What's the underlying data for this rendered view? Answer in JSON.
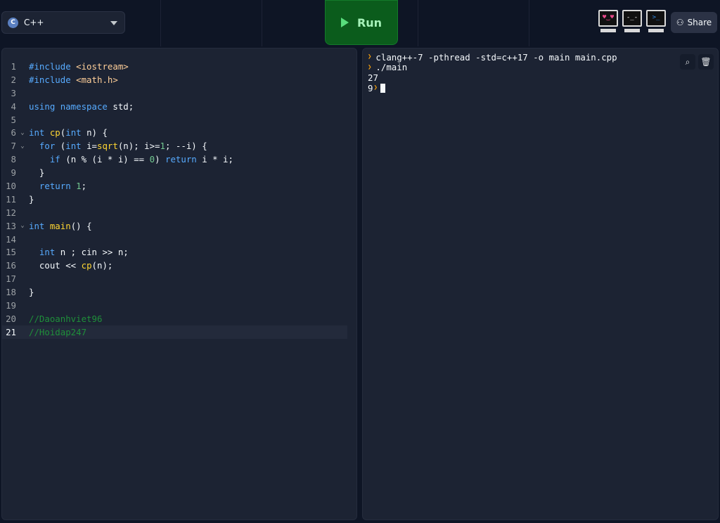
{
  "header": {
    "language": "C++",
    "run_label": "Run",
    "share_label": "Share",
    "avatars": [
      {
        "face": "♥‿♥",
        "color": "#e84a8a"
      },
      {
        "face": "-_-",
        "color": "#cccccc"
      },
      {
        "face": ">_",
        "color": "#2f8be8"
      }
    ]
  },
  "editor": {
    "active_line": 21,
    "lines": [
      {
        "n": "1",
        "fold": false,
        "html": [
          [
            "c-pp",
            "#include "
          ],
          [
            "c-str",
            "<iostream>"
          ]
        ]
      },
      {
        "n": "2",
        "fold": false,
        "html": [
          [
            "c-pp",
            "#include "
          ],
          [
            "c-str",
            "<math.h>"
          ]
        ]
      },
      {
        "n": "3",
        "fold": false,
        "html": []
      },
      {
        "n": "4",
        "fold": false,
        "html": [
          [
            "c-kw",
            "using namespace "
          ],
          [
            "c-txt",
            "std;"
          ]
        ]
      },
      {
        "n": "5",
        "fold": false,
        "html": []
      },
      {
        "n": "6",
        "fold": true,
        "html": [
          [
            "c-kw",
            "int "
          ],
          [
            "c-fn",
            "cp"
          ],
          [
            "c-txt",
            "("
          ],
          [
            "c-kw",
            "int "
          ],
          [
            "c-txt",
            "n) {"
          ]
        ]
      },
      {
        "n": "7",
        "fold": true,
        "html": [
          [
            "c-txt",
            "  "
          ],
          [
            "c-kw",
            "for "
          ],
          [
            "c-txt",
            "("
          ],
          [
            "c-kw",
            "int "
          ],
          [
            "c-txt",
            "i="
          ],
          [
            "c-fn",
            "sqrt"
          ],
          [
            "c-txt",
            "(n); i>="
          ],
          [
            "c-num",
            "1"
          ],
          [
            "c-txt",
            "; --i) {"
          ]
        ]
      },
      {
        "n": "8",
        "fold": false,
        "html": [
          [
            "c-txt",
            "    "
          ],
          [
            "c-kw",
            "if "
          ],
          [
            "c-txt",
            "(n % (i * i) == "
          ],
          [
            "c-num",
            "0"
          ],
          [
            "c-txt",
            ") "
          ],
          [
            "c-kw",
            "return "
          ],
          [
            "c-txt",
            "i * i;"
          ]
        ]
      },
      {
        "n": "9",
        "fold": false,
        "html": [
          [
            "c-txt",
            "  }"
          ]
        ]
      },
      {
        "n": "10",
        "fold": false,
        "html": [
          [
            "c-txt",
            "  "
          ],
          [
            "c-kw",
            "return "
          ],
          [
            "c-num",
            "1"
          ],
          [
            "c-txt",
            ";"
          ]
        ]
      },
      {
        "n": "11",
        "fold": false,
        "html": [
          [
            "c-txt",
            "}"
          ]
        ]
      },
      {
        "n": "12",
        "fold": false,
        "html": []
      },
      {
        "n": "13",
        "fold": true,
        "html": [
          [
            "c-kw",
            "int "
          ],
          [
            "c-fn",
            "main"
          ],
          [
            "c-txt",
            "() {"
          ]
        ]
      },
      {
        "n": "14",
        "fold": false,
        "html": []
      },
      {
        "n": "15",
        "fold": false,
        "html": [
          [
            "c-txt",
            "  "
          ],
          [
            "c-kw",
            "int "
          ],
          [
            "c-txt",
            "n ; cin >> n;"
          ]
        ]
      },
      {
        "n": "16",
        "fold": false,
        "html": [
          [
            "c-txt",
            "  cout << "
          ],
          [
            "c-fn",
            "cp"
          ],
          [
            "c-txt",
            "(n);"
          ]
        ]
      },
      {
        "n": "17",
        "fold": false,
        "html": []
      },
      {
        "n": "18",
        "fold": false,
        "html": [
          [
            "c-txt",
            "}"
          ]
        ]
      },
      {
        "n": "19",
        "fold": false,
        "html": []
      },
      {
        "n": "20",
        "fold": false,
        "html": [
          [
            "c-cm",
            "//Daoanhviet96"
          ]
        ]
      },
      {
        "n": "21",
        "fold": false,
        "html": [
          [
            "c-cm",
            "//Hoidap247"
          ]
        ]
      }
    ]
  },
  "console": {
    "lines": [
      {
        "prompt": true,
        "text": "clang++-7 -pthread -std=c++17 -o main main.cpp"
      },
      {
        "prompt": true,
        "text": "./main"
      },
      {
        "prompt": false,
        "text": "27"
      },
      {
        "prompt": false,
        "text": "9",
        "inline_prompt": true,
        "cursor": true
      }
    ]
  },
  "colors": {
    "accent_run": "#0b5c1c",
    "background": "#0e1525",
    "panel": "#1c2333"
  }
}
